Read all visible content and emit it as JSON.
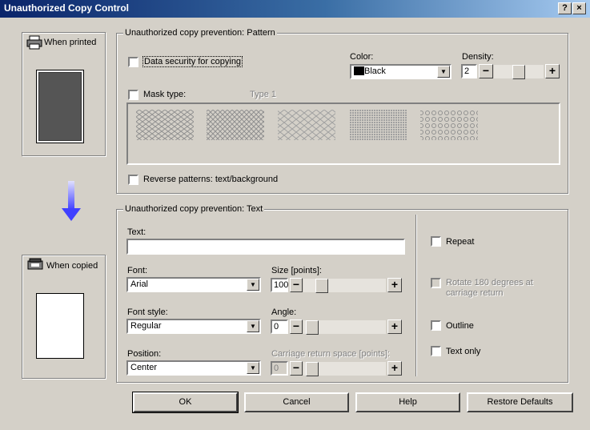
{
  "window": {
    "title": "Unauthorized Copy Control",
    "help_btn": "?",
    "close_btn": "×"
  },
  "left": {
    "when_printed": "When printed",
    "when_copied": "When copied"
  },
  "pattern": {
    "group_title": "Unauthorized copy prevention: Pattern",
    "data_security_label": "Data security for copying",
    "color_label": "Color:",
    "color_value": "Black",
    "color_swatch": "#000000",
    "density_label": "Density:",
    "density_value": "2",
    "density_level": 0.5,
    "mask_label": "Mask type:",
    "mask_value": "Type 1",
    "reverse_label": "Reverse patterns: text/background"
  },
  "text": {
    "group_title": "Unauthorized copy prevention: Text",
    "text_label": "Text:",
    "text_value": "",
    "font_label": "Font:",
    "font_value": "Arial",
    "size_label": "Size [points]:",
    "size_value": "100",
    "font_style_label": "Font style:",
    "font_style_value": "Regular",
    "angle_label": "Angle:",
    "angle_value": "0",
    "position_label": "Position:",
    "position_value": "Center",
    "cr_space_label": "Carriage return space [points]:",
    "cr_space_value": "0",
    "repeat_label": "Repeat",
    "rotate_label": "Rotate 180 degrees at carriage return",
    "outline_label": "Outline",
    "text_only_label": "Text only"
  },
  "spin": {
    "minus": "−",
    "plus": "+"
  },
  "buttons": {
    "ok": "OK",
    "cancel": "Cancel",
    "help": "Help",
    "restore": "Restore Defaults"
  },
  "colors": {
    "titlebar_start": "#0a246a",
    "arrow": "#4040ff",
    "face": "#d4d0c8"
  }
}
